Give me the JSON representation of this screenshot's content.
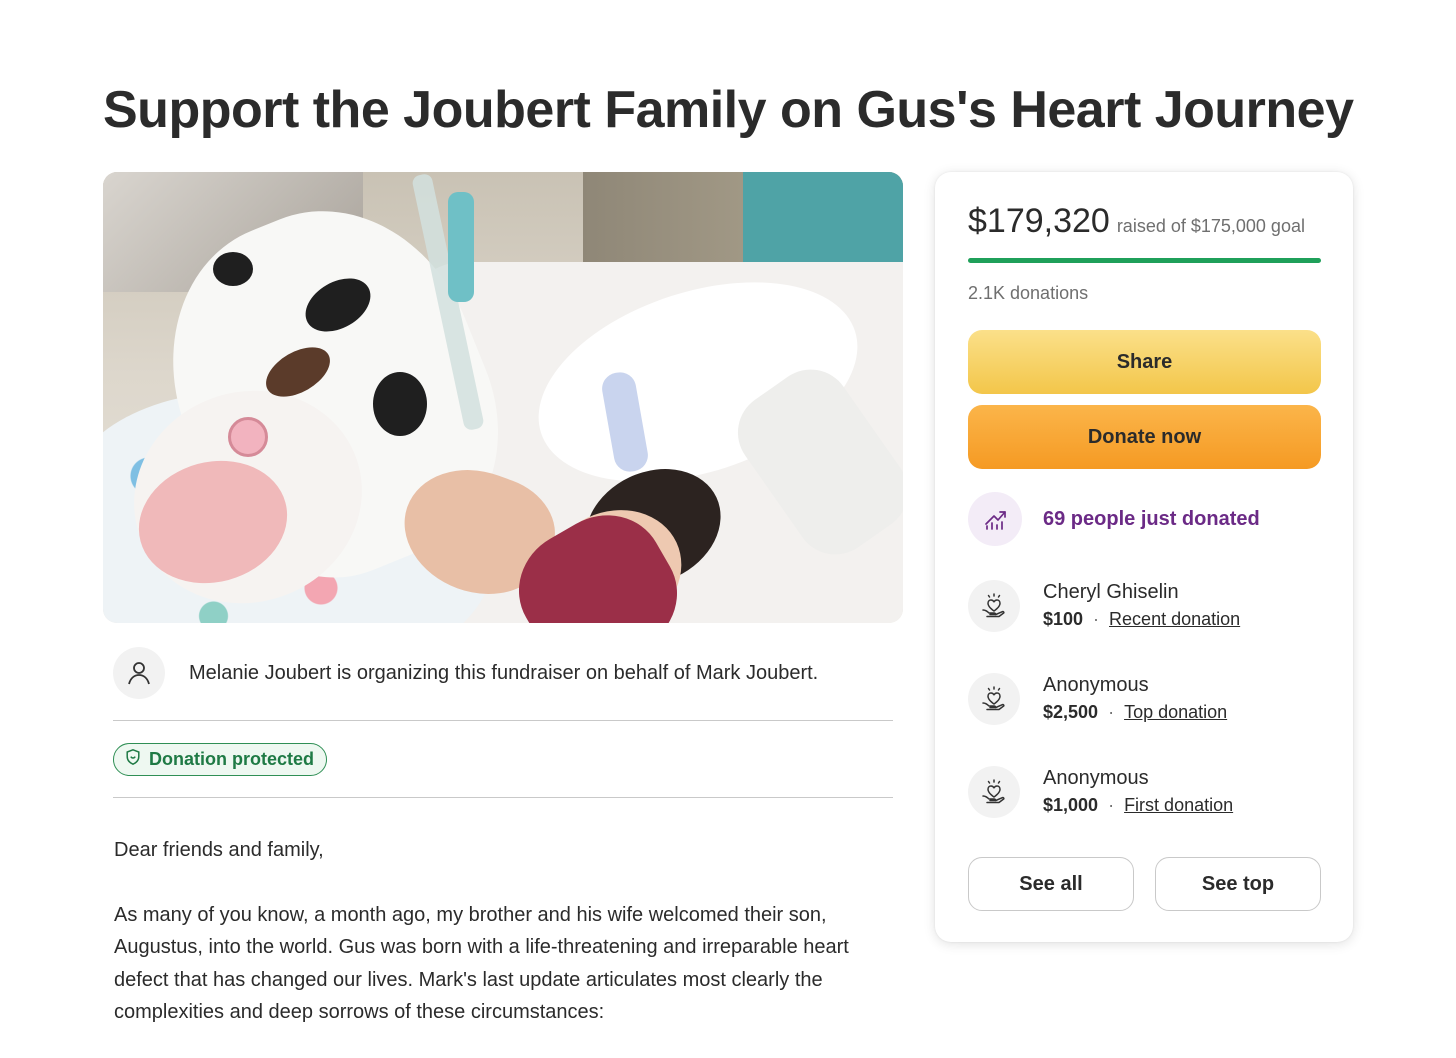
{
  "page": {
    "title": "Support the Joubert Family on Gus's Heart Journey"
  },
  "organizer": {
    "text": "Melanie Joubert is organizing this fundraiser on behalf of Mark Joubert."
  },
  "badge": {
    "label": "Donation protected"
  },
  "story": {
    "paragraphs": [
      "Dear friends and family,",
      "As many of you know, a month ago, my brother and his wife welcomed their son, Augustus, into the world. Gus was born with a life-threatening and irreparable heart defect that has changed our lives. Mark's last update articulates most clearly the complexities and deep sorrows of these circumstances:"
    ]
  },
  "progress": {
    "raised": "$179,320",
    "goal_text": "raised of $175,000 goal",
    "fraction": 1.0,
    "donations": "2.1K donations"
  },
  "buttons": {
    "share": "Share",
    "donate": "Donate now",
    "see_all": "See all",
    "see_top": "See top"
  },
  "activity": {
    "text": "69 people just donated"
  },
  "donors": [
    {
      "name": "Cheryl Ghiselin",
      "amount": "$100",
      "dot": "·",
      "tag": "Recent donation"
    },
    {
      "name": "Anonymous",
      "amount": "$2,500",
      "dot": "·",
      "tag": "Top donation"
    },
    {
      "name": "Anonymous",
      "amount": "$1,000",
      "dot": "·",
      "tag": "First donation"
    }
  ],
  "colors": {
    "progress": "#1fa05a",
    "share": "#f3c64a",
    "donate": "#f59a23",
    "activity": "#6b2a86",
    "protected": "#1f7a45"
  },
  "icons": {
    "organizer": "user-icon",
    "badge": "shield-icon",
    "activity": "trending-up-icon",
    "donor": "heart-hand-icon"
  }
}
